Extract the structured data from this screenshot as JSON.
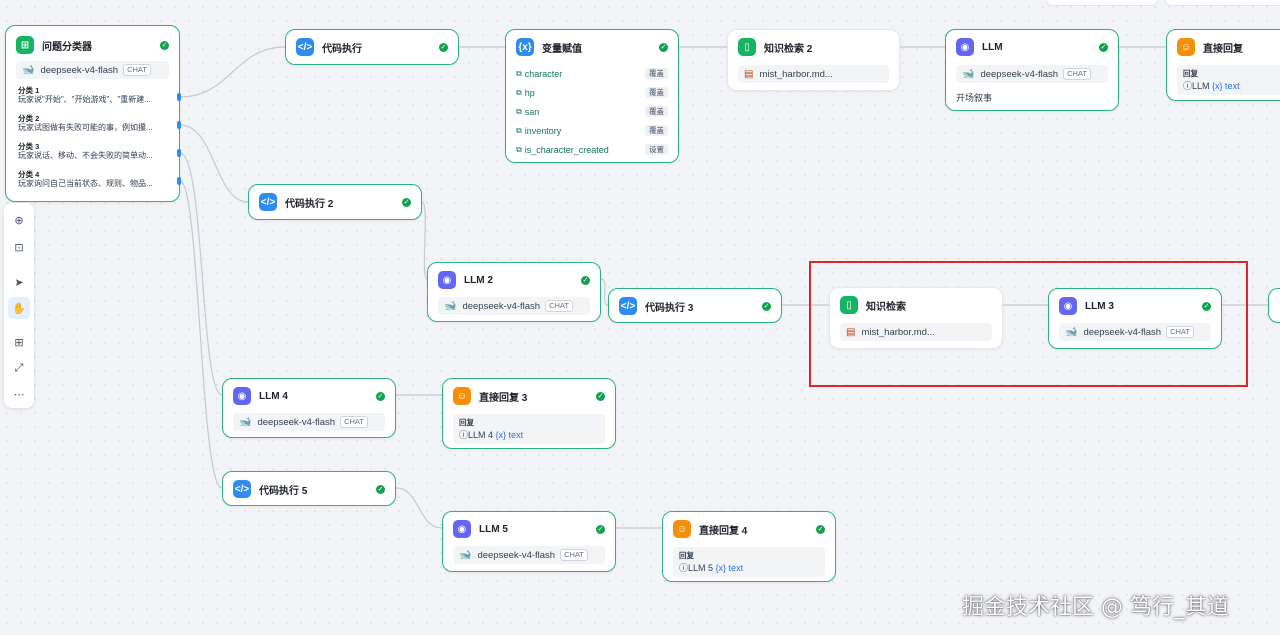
{
  "colors": {
    "accent": "#2db37d",
    "handle": "#2e8cf0",
    "highlight": "#d9272e"
  },
  "classifier": {
    "title": "问题分类器",
    "model": "deepseek-v4-flash",
    "mode": "CHAT",
    "classes": [
      {
        "label": "分类 1",
        "text": "玩家说\"开始\"、\"开始游戏\"、\"重新建..."
      },
      {
        "label": "分类 2",
        "text": "玩家试图做有失败可能的事，例如攥..."
      },
      {
        "label": "分类 3",
        "text": "玩家说话、移动、不会失败的简单动..."
      },
      {
        "label": "分类 4",
        "text": "玩家询问自己当前状态、规则、物品..."
      }
    ]
  },
  "code1": {
    "title": "代码执行"
  },
  "assign": {
    "title": "变量赋值",
    "vars": [
      {
        "name": "character",
        "op": "覆盖"
      },
      {
        "name": "hp",
        "op": "覆盖"
      },
      {
        "name": "san",
        "op": "覆盖"
      },
      {
        "name": "inventory",
        "op": "覆盖"
      },
      {
        "name": "is_character_created",
        "op": "设置"
      }
    ]
  },
  "kr2": {
    "title": "知识检索 2",
    "file": "mist_harbor.md..."
  },
  "llm1": {
    "title": "LLM",
    "model": "deepseek-v4-flash",
    "mode": "CHAT",
    "desc": "开场叙事"
  },
  "reply1": {
    "title": "直接回复",
    "label": "回复",
    "ref_node": "LLM",
    "ref_var": "{x} text"
  },
  "code2": {
    "title": "代码执行 2"
  },
  "llm2": {
    "title": "LLM 2",
    "model": "deepseek-v4-flash",
    "mode": "CHAT"
  },
  "code3": {
    "title": "代码执行 3"
  },
  "kr": {
    "title": "知识检索",
    "file": "mist_harbor.md..."
  },
  "llm3": {
    "title": "LLM 3",
    "model": "deepseek-v4-flash",
    "mode": "CHAT"
  },
  "llm4": {
    "title": "LLM 4",
    "model": "deepseek-v4-flash",
    "mode": "CHAT"
  },
  "reply3": {
    "title": "直接回复 3",
    "label": "回复",
    "ref_node": "LLM 4",
    "ref_var": "{x} text"
  },
  "code5": {
    "title": "代码执行 5"
  },
  "llm5": {
    "title": "LLM 5",
    "model": "deepseek-v4-flash",
    "mode": "CHAT"
  },
  "reply4": {
    "title": "直接回复 4",
    "label": "回复",
    "ref_node": "LLM 5",
    "ref_var": "{x} text"
  },
  "toolbar": {
    "icons": [
      "add-node-icon",
      "note-icon",
      "pointer-icon",
      "hand-icon",
      "organize-icon",
      "fit-view-icon",
      "more-icon"
    ]
  },
  "watermark": "掘金技术社区 @ 笃行_其道"
}
